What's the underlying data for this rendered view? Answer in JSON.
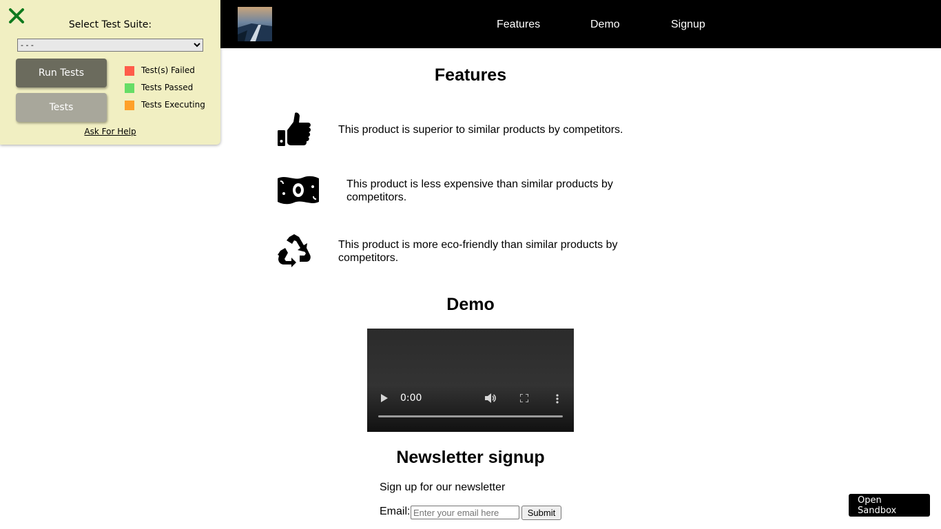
{
  "header": {
    "logo_alt": "logo",
    "nav": [
      {
        "label": "Features"
      },
      {
        "label": "Demo"
      },
      {
        "label": "Signup"
      }
    ]
  },
  "features": {
    "title": "Features",
    "items": [
      {
        "icon": "thumbs-up-icon",
        "text": "This product is superior to similar products by competitors."
      },
      {
        "icon": "money-bill-icon",
        "text": "This product is less expensive than similar products by competitors."
      },
      {
        "icon": "recycle-icon",
        "text": "This product is more eco-friendly than similar products by competitors."
      }
    ]
  },
  "demo": {
    "title": "Demo",
    "video": {
      "time": "0:00"
    }
  },
  "signup": {
    "title": "Newsletter signup",
    "text": "Sign up for our newsletter",
    "email_label": "Email:",
    "email_placeholder": "Enter your email here",
    "email_value": "",
    "submit_label": "Submit"
  },
  "test_panel": {
    "suite_label": "Select Test Suite:",
    "suite_selected": "- - -",
    "run_label": "Run Tests",
    "tests_label": "Tests",
    "legend": [
      {
        "label": "Test(s) Failed",
        "color": "#ff5c4a"
      },
      {
        "label": "Tests Passed",
        "color": "#66dd66"
      },
      {
        "label": "Tests Executing",
        "color": "#ffa12a"
      }
    ],
    "help_label": "Ask For Help"
  },
  "sandbox": {
    "label": "Open Sandbox"
  },
  "colors": {
    "header_bg": "#000000",
    "panel_bg": "#f1efc2",
    "close_icon": "#0f7a1e"
  }
}
